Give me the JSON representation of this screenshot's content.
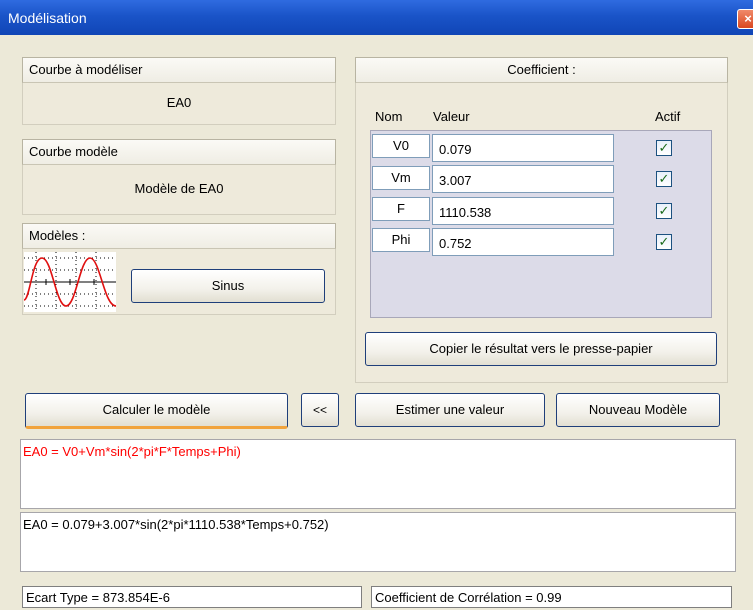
{
  "window": {
    "title": "Modélisation",
    "close_glyph": "×"
  },
  "curve_to_model": {
    "header": "Courbe à modéliser",
    "value": "EA0"
  },
  "model_curve": {
    "header": "Courbe modèle",
    "value": "Modèle de EA0"
  },
  "models": {
    "header": "Modèles :",
    "preview_icon": "sine-wave-icon",
    "button_label": "Sinus"
  },
  "coefficients": {
    "header": "Coefficient :",
    "columns": {
      "name": "Nom",
      "value": "Valeur",
      "active": "Actif"
    },
    "rows": [
      {
        "name": "V0",
        "value": "0.079",
        "active": true
      },
      {
        "name": "Vm",
        "value": "3.007",
        "active": true
      },
      {
        "name": "F",
        "value": "1110.538",
        "active": true
      },
      {
        "name": "Phi",
        "value": "0.752",
        "active": true
      }
    ],
    "copy_button": "Copier le résultat vers le presse-papier"
  },
  "actions": {
    "compute": "Calculer le modèle",
    "collapse": "<<",
    "estimate": "Estimer une valeur",
    "new_model": "Nouveau Modèle"
  },
  "formula": {
    "text": "EA0 = V0+Vm*sin(2*pi*F*Temps+Phi)",
    "color": "#ff0000"
  },
  "result": {
    "text": "EA0 = 0.079+3.007*sin(2*pi*1110.538*Temps+0.752)"
  },
  "status": {
    "std_dev": "Ecart Type = 873.854E-6",
    "correlation": "Coefficient de Corrélation = 0.99"
  },
  "colors": {
    "titlebar": "#1a54c8",
    "check": "#1a6a1a",
    "accent_orange": "#f1a33c"
  }
}
